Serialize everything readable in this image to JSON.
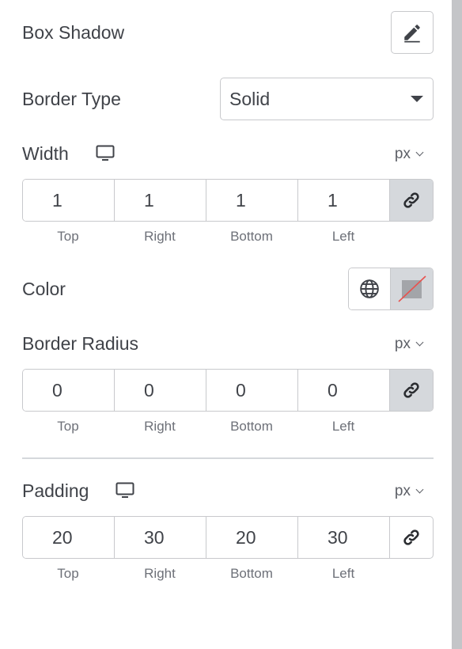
{
  "box_shadow": {
    "label": "Box Shadow",
    "edit_icon": "pencil-icon"
  },
  "border_type": {
    "label": "Border Type",
    "value": "Solid"
  },
  "width": {
    "label": "Width",
    "device_icon": "desktop-icon",
    "unit": "px",
    "values": [
      "1",
      "1",
      "1",
      "1"
    ],
    "sides": [
      "Top",
      "Right",
      "Bottom",
      "Left"
    ],
    "linked": true
  },
  "color": {
    "label": "Color",
    "global_icon": "globe-icon",
    "swatch": "none"
  },
  "border_radius": {
    "label": "Border Radius",
    "unit": "px",
    "values": [
      "0",
      "0",
      "0",
      "0"
    ],
    "sides": [
      "Top",
      "Right",
      "Bottom",
      "Left"
    ],
    "linked": true
  },
  "padding": {
    "label": "Padding",
    "device_icon": "desktop-icon",
    "unit": "px",
    "values": [
      "20",
      "30",
      "20",
      "30"
    ],
    "sides": [
      "Top",
      "Right",
      "Bottom",
      "Left"
    ],
    "linked": false
  },
  "colors": {
    "text": "#404349",
    "border": "#c8c9cc",
    "active_bg": "#d5d8dc",
    "strike": "#e8524e"
  }
}
